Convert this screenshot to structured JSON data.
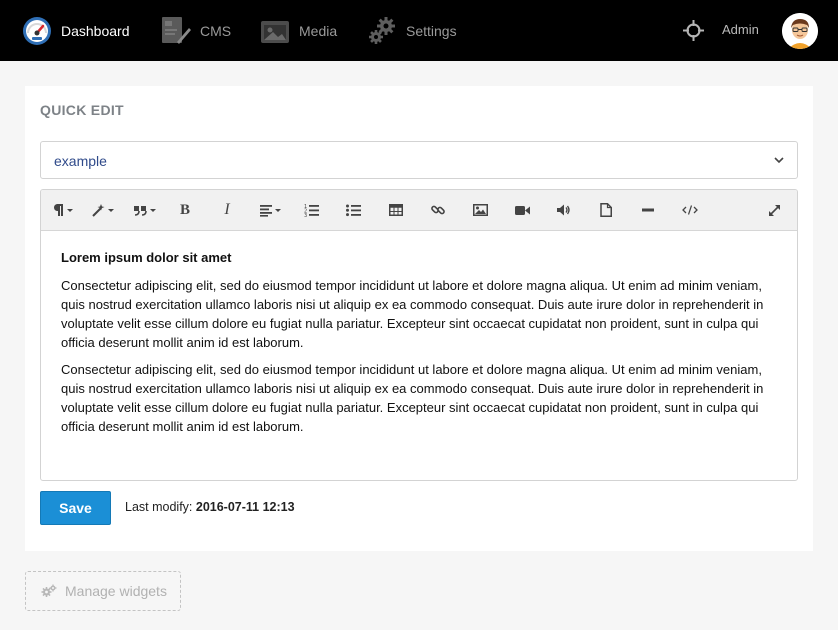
{
  "navbar": {
    "dashboard": "Dashboard",
    "cms": "CMS",
    "media": "Media",
    "settings": "Settings",
    "admin": "Admin"
  },
  "panel": {
    "title": "QUICK EDIT",
    "select_value": "example",
    "content": {
      "heading": "Lorem ipsum dolor sit amet",
      "paragraphs": [
        "Consectetur adipiscing elit, sed do eiusmod tempor incididunt ut labore et dolore magna aliqua. Ut enim ad minim veniam, quis nostrud exercitation ullamco laboris nisi ut aliquip ex ea commodo consequat. Duis aute irure dolor in reprehenderit in voluptate velit esse cillum dolore eu fugiat nulla pariatur. Excepteur sint occaecat cupidatat non proident, sunt in culpa qui officia deserunt mollit anim id est laborum.",
        "Consectetur adipiscing elit, sed do eiusmod tempor incididunt ut labore et dolore magna aliqua. Ut enim ad minim veniam, quis nostrud exercitation ullamco laboris nisi ut aliquip ex ea commodo consequat. Duis aute irure dolor in reprehenderit in voluptate velit esse cillum dolore eu fugiat nulla pariatur. Excepteur sint occaecat cupidatat non proident, sunt in culpa qui officia deserunt mollit anim id est laborum."
      ]
    },
    "save_label": "Save",
    "last_modify_label": "Last modify:",
    "last_modify_value": "2016-07-11 12:13"
  },
  "manage_widgets_label": "Manage widgets",
  "toolbar_icons": [
    "paragraph-icon",
    "magic-wand-icon",
    "quote-icon",
    "bold-icon",
    "italic-icon",
    "align-icon",
    "ordered-list-icon",
    "unordered-list-icon",
    "table-icon",
    "link-icon",
    "image-icon",
    "video-icon",
    "audio-icon",
    "file-icon",
    "horizontal-rule-icon",
    "code-view-icon",
    "fullscreen-icon"
  ],
  "colors": {
    "navbar_bg": "#000000",
    "primary": "#1b8fd6",
    "select_text": "#2f4a8a",
    "title_gray": "#7d8287"
  }
}
